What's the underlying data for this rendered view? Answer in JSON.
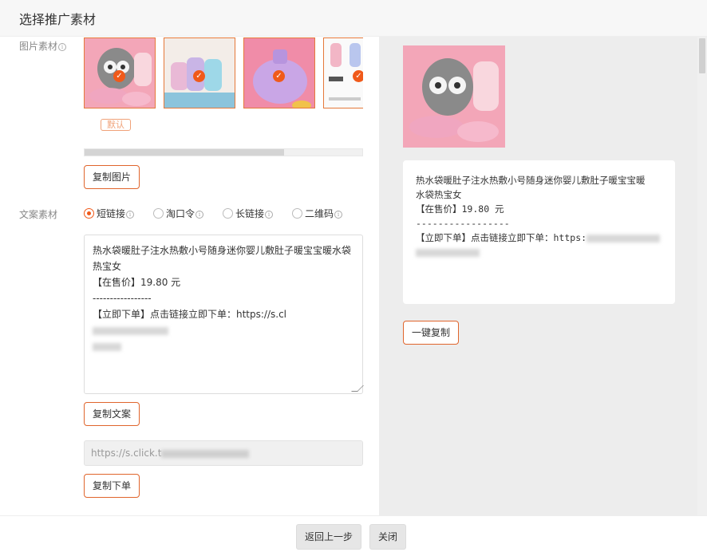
{
  "header": {
    "title": "选择推广素材"
  },
  "images": {
    "label": "图片素材",
    "default_tag": "默认",
    "copy_button": "复制图片"
  },
  "copy": {
    "label": "文案素材",
    "options": [
      {
        "label": "短链接",
        "selected": true
      },
      {
        "label": "淘口令",
        "selected": false
      },
      {
        "label": "长链接",
        "selected": false
      },
      {
        "label": "二维码",
        "selected": false
      }
    ],
    "text_lines": [
      "热水袋暖肚子注水热敷小号随身迷你婴儿敷肚子暖宝宝暖水袋",
      "热宝女",
      "【在售价】19.80 元",
      "-----------------",
      "【立即下单】点击链接立即下单：https://s.cl"
    ],
    "copy_text_button": "复制文案",
    "link_value": "https://s.click.t",
    "copy_order_button": "复制下单"
  },
  "preview": {
    "lines": [
      "热水袋暖肚子注水热敷小号随身迷你婴儿敷肚子暖宝宝暖",
      "水袋热宝女",
      "【在售价】19.80 元",
      "-----------------",
      "【立即下单】点击链接立即下单：https:"
    ],
    "one_click_copy": "一键复制"
  },
  "footer": {
    "back": "返回上一步",
    "close": "关闭"
  },
  "colors": {
    "accent": "#f05a1a",
    "border_accent": "#e0652c"
  }
}
